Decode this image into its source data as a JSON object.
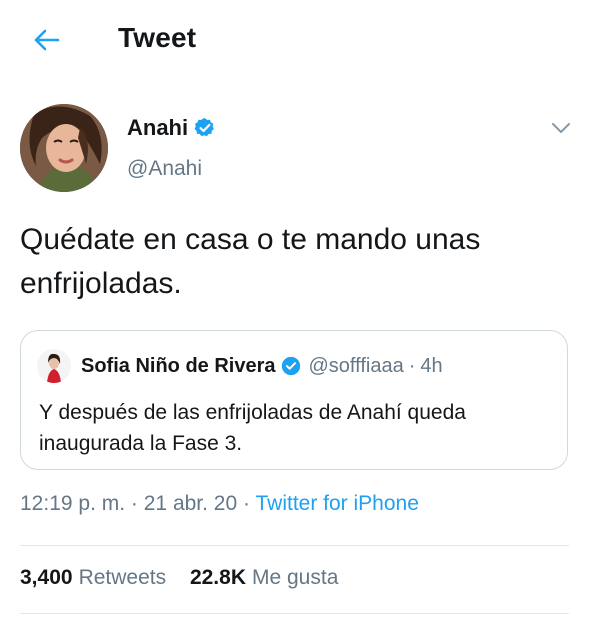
{
  "header": {
    "back_icon": "arrow-left-icon",
    "title": "Tweet"
  },
  "tweet": {
    "author": {
      "name": "Anahi",
      "handle": "@Anahi",
      "verified": true,
      "avatar": "profile-photo"
    },
    "menu_icon": "chevron-down-icon",
    "text": "Quédate en casa o te mando unas enfrijoladas.",
    "quote": {
      "author_name": "Sofia Niño de Rivera",
      "author_handle": "@sofffiaaa",
      "separator": "·",
      "time": "4h",
      "verified": true,
      "text": "Y después de las enfrijoladas de Anahí queda inaugurada la Fase 3."
    },
    "meta": {
      "time": "12:19 p. m.",
      "separator": "·",
      "date": "21 abr. 20",
      "source": "Twitter for iPhone"
    },
    "stats": {
      "retweets_count": "3,400",
      "retweets_label": "Retweets",
      "likes_count": "22.8K",
      "likes_label": "Me gusta"
    }
  },
  "colors": {
    "accent": "#1da1f2",
    "text_primary": "#14171a",
    "text_secondary": "#657786",
    "border": "#cfd9de"
  }
}
